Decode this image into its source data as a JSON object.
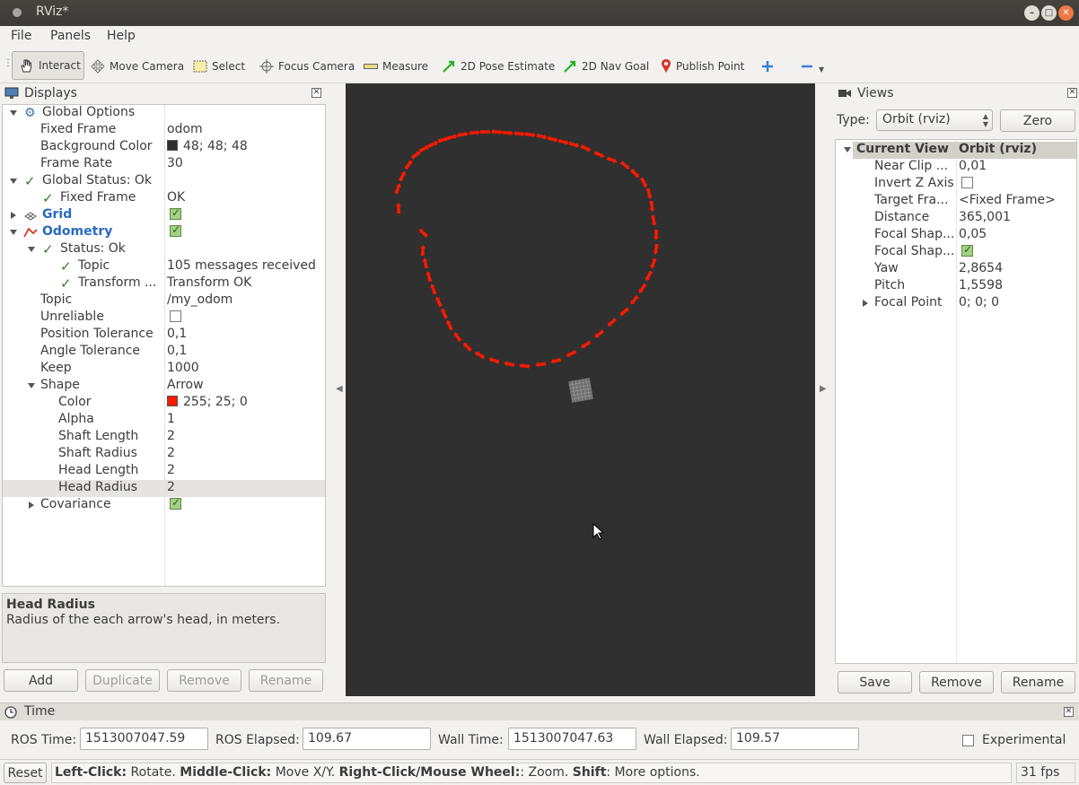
{
  "window": {
    "title": "RViz*"
  },
  "menubar": [
    "File",
    "Panels",
    "Help"
  ],
  "toolbar": {
    "interact": "Interact",
    "move_camera": "Move Camera",
    "select": "Select",
    "focus_camera": "Focus Camera",
    "measure": "Measure",
    "pose_estimate": "2D Pose Estimate",
    "nav_goal": "2D Nav Goal",
    "publish_point": "Publish Point"
  },
  "displays": {
    "title": "Displays",
    "rows": {
      "global_options": "Global Options",
      "fixed_frame": "Fixed Frame",
      "fixed_frame_val": "odom",
      "bg_color": "Background Color",
      "bg_color_val": "48; 48; 48",
      "frame_rate": "Frame Rate",
      "frame_rate_val": "30",
      "global_status": "Global Status: Ok",
      "gs_fixed_frame": "Fixed Frame",
      "gs_fixed_frame_val": "OK",
      "grid": "Grid",
      "odometry": "Odometry",
      "status_ok": "Status: Ok",
      "topic_status": "Topic",
      "topic_status_val": "105 messages received",
      "transform": "Transform ...",
      "transform_val": "Transform OK",
      "topic": "Topic",
      "topic_val": "/my_odom",
      "unreliable": "Unreliable",
      "pos_tol": "Position Tolerance",
      "pos_tol_val": "0,1",
      "ang_tol": "Angle Tolerance",
      "ang_tol_val": "0,1",
      "keep": "Keep",
      "keep_val": "1000",
      "shape": "Shape",
      "shape_val": "Arrow",
      "color": "Color",
      "color_val": "255; 25; 0",
      "alpha": "Alpha",
      "alpha_val": "1",
      "shaft_length": "Shaft Length",
      "shaft_length_val": "2",
      "shaft_radius": "Shaft Radius",
      "shaft_radius_val": "2",
      "head_length": "Head Length",
      "head_length_val": "2",
      "head_radius": "Head Radius",
      "head_radius_val": "2",
      "covariance": "Covariance"
    },
    "desc_title": "Head Radius",
    "desc_text": "Radius of the each arrow's head, in meters.",
    "buttons": {
      "add": "Add",
      "duplicate": "Duplicate",
      "remove": "Remove",
      "rename": "Rename"
    }
  },
  "views": {
    "title": "Views",
    "type_label": "Type:",
    "type_value": "Orbit (rviz)",
    "zero": "Zero",
    "header_name": "Current View",
    "header_val": "Orbit (rviz)",
    "rows": {
      "near_clip": "Near Clip ...",
      "near_clip_val": "0,01",
      "invert_z": "Invert Z Axis",
      "target_frame": "Target Fra...",
      "target_frame_val": "<Fixed Frame>",
      "distance": "Distance",
      "distance_val": "365,001",
      "focal1": "Focal Shap...",
      "focal1_val": "0,05",
      "focal2": "Focal Shap...",
      "yaw": "Yaw",
      "yaw_val": "2,8654",
      "pitch": "Pitch",
      "pitch_val": "1,5598",
      "focal_point": "Focal Point",
      "focal_point_val": "0; 0; 0"
    },
    "buttons": {
      "save": "Save",
      "remove": "Remove",
      "rename": "Rename"
    }
  },
  "time": {
    "title": "Time",
    "ros_time_label": "ROS Time:",
    "ros_time": "1513007047.59",
    "ros_elapsed_label": "ROS Elapsed:",
    "ros_elapsed": "109.67",
    "wall_time_label": "Wall Time:",
    "wall_time": "1513007047.63",
    "wall_elapsed_label": "Wall Elapsed:",
    "wall_elapsed": "109.57",
    "experimental": "Experimental"
  },
  "status": {
    "reset": "Reset",
    "left_click": "Left-Click:",
    "left_desc": " Rotate. ",
    "middle_click": "Middle-Click:",
    "middle_desc": " Move X/Y. ",
    "right_click": "Right-Click/Mouse Wheel:",
    "right_desc": ": Zoom. ",
    "shift": "Shift",
    "shift_desc": ": More options.",
    "fps": "31 fps"
  },
  "colors": {
    "viewport_bg": "#303030",
    "arrow": "#ff1900"
  }
}
